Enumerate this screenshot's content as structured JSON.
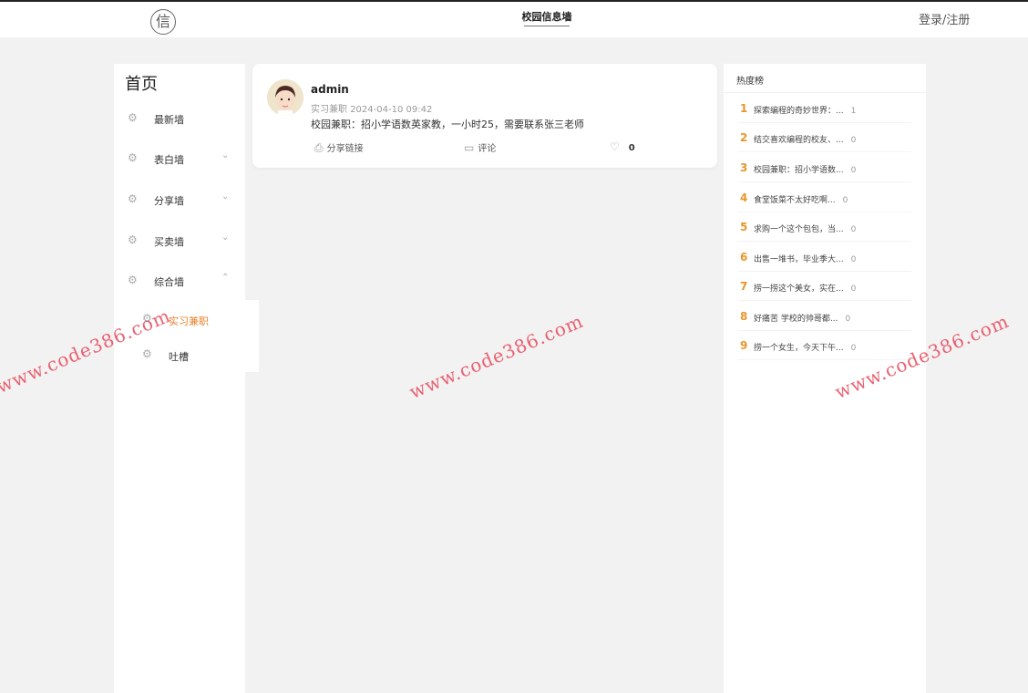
{
  "header": {
    "logo_char": "信",
    "site_title": "校园信息墙",
    "login_label": "登录/注册"
  },
  "sidebar": {
    "home": "首页",
    "items": [
      {
        "label": "最新墙",
        "expandable": false,
        "icon": "gear-icon"
      },
      {
        "label": "表白墙",
        "expandable": true,
        "expanded": false,
        "icon": "gear-icon"
      },
      {
        "label": "分享墙",
        "expandable": true,
        "expanded": false,
        "icon": "gear-icon"
      },
      {
        "label": "买卖墙",
        "expandable": true,
        "expanded": false,
        "icon": "gear-icon"
      },
      {
        "label": "综合墙",
        "expandable": true,
        "expanded": true,
        "icon": "gear-icon"
      }
    ],
    "submenu": [
      {
        "label": "实习兼职",
        "active": true
      },
      {
        "label": "吐槽",
        "active": false
      }
    ],
    "chevron_down": "⌄",
    "chevron_up": "⌃",
    "gear": "⚙"
  },
  "post": {
    "username": "admin",
    "category": "实习兼职",
    "time": "2024-04-10 09:42",
    "content": "校园兼职：招小学语数英家教，一小时25，需要联系张三老师",
    "share_label": "分享链接",
    "comment_label": "评论",
    "like_count": "0"
  },
  "hot": {
    "title": "热度榜",
    "items": [
      {
        "rank": "1",
        "text": "探索编程的奇妙世界：...",
        "count": "1"
      },
      {
        "rank": "2",
        "text": "结交喜欢编程的校友、...",
        "count": "0"
      },
      {
        "rank": "3",
        "text": "校园兼职：招小学语数...",
        "count": "0"
      },
      {
        "rank": "4",
        "text": "食堂饭菜不太好吃啊...",
        "count": "0"
      },
      {
        "rank": "5",
        "text": "求购一个这个包包，当...",
        "count": "0"
      },
      {
        "rank": "6",
        "text": "出售一堆书，毕业季大...",
        "count": "0"
      },
      {
        "rank": "7",
        "text": "捞一捞这个美女，实在...",
        "count": "0"
      },
      {
        "rank": "8",
        "text": "好痛苦 学校的帅哥都...",
        "count": "0"
      },
      {
        "rank": "9",
        "text": "捞一个女生，今天下午...",
        "count": "0"
      }
    ]
  },
  "watermark": "www.code386.com",
  "colors": {
    "accent": "#e8812a",
    "rank": "#e8962a",
    "watermark": "#e8465a"
  }
}
